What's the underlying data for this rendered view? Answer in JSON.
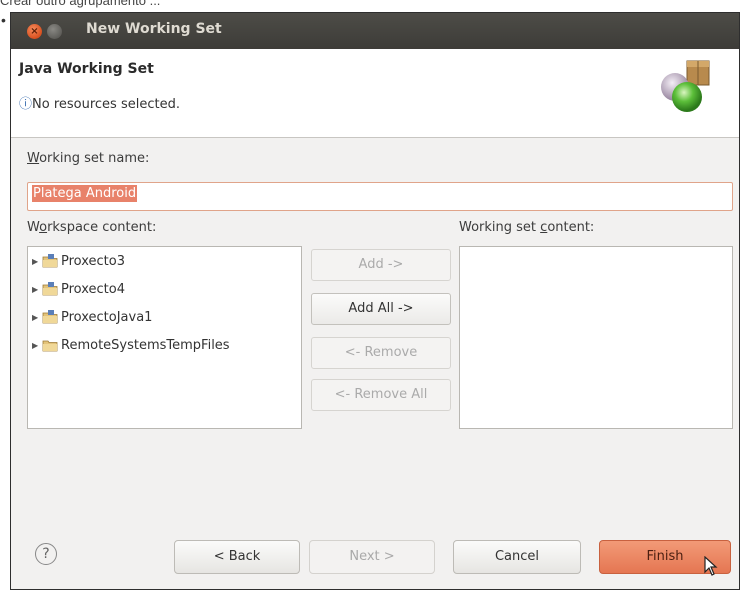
{
  "caption": "Crear outro agrupamento ...",
  "bullet": "•",
  "window": {
    "title": "New Working Set"
  },
  "header": {
    "title": "Java Working Set",
    "info_symbol": "ⓘ",
    "message": "No resources selected."
  },
  "form": {
    "name_label_prefix": "W",
    "name_label_rest": "orking set name:",
    "name_value": "Platega Android",
    "workspace_label_a": "W",
    "workspace_label_u": "o",
    "workspace_label_b": "rkspace content:",
    "workingset_label_a": "Working set ",
    "workingset_label_u": "c",
    "workingset_label_b": "ontent:"
  },
  "workspace_items": [
    {
      "label": "Proxecto3",
      "icon": "java-project-icon"
    },
    {
      "label": "Proxecto4",
      "icon": "java-project-icon"
    },
    {
      "label": "ProxectoJava1",
      "icon": "java-project-icon"
    },
    {
      "label": "RemoteSystemsTempFiles",
      "icon": "folder-icon"
    }
  ],
  "buttons": {
    "add": "Add ->",
    "add_all": "Add All ->",
    "remove": "<- Remove",
    "remove_all": "<- Remove All",
    "back": "< Back",
    "next": "Next >",
    "cancel": "Cancel",
    "finish": "Finish",
    "help": "?"
  },
  "colors": {
    "accent": "#e57652",
    "selection": "#e8826a",
    "titlebar": "#3d3c38"
  }
}
